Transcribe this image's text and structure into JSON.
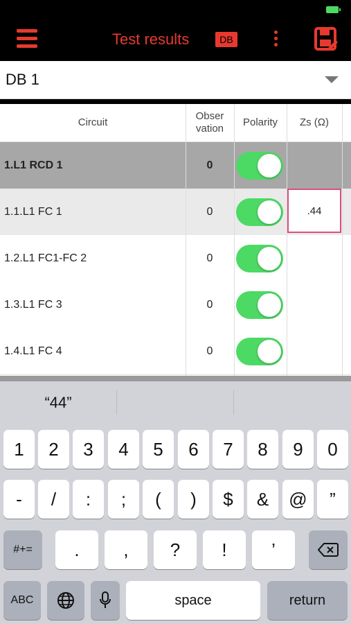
{
  "header": {
    "title": "Test results",
    "db_badge": "DB"
  },
  "db_selector": {
    "value": "DB 1"
  },
  "table": {
    "columns": [
      "Circuit",
      "Obser vation",
      "Polarity",
      "Zs (Ω)"
    ],
    "rows": [
      {
        "circuit": "1.L1 RCD 1",
        "observation": "0",
        "polarity_on": true,
        "zs": ""
      },
      {
        "circuit": "1.1.L1 FC 1",
        "observation": "0",
        "polarity_on": true,
        "zs": ".44"
      },
      {
        "circuit": "1.2.L1 FC1-FC 2",
        "observation": "0",
        "polarity_on": true,
        "zs": ""
      },
      {
        "circuit": "1.3.L1 FC 3",
        "observation": "0",
        "polarity_on": true,
        "zs": ""
      },
      {
        "circuit": "1.4.L1 FC 4",
        "observation": "0",
        "polarity_on": true,
        "zs": ""
      }
    ]
  },
  "keyboard": {
    "suggestions": [
      "“44”",
      "",
      ""
    ],
    "row1": [
      "1",
      "2",
      "3",
      "4",
      "5",
      "6",
      "7",
      "8",
      "9",
      "0"
    ],
    "row2": [
      "-",
      "/",
      ":",
      ";",
      "(",
      ")",
      "$",
      "&",
      "@",
      "”"
    ],
    "row3": [
      "#+=",
      ".",
      ",",
      "?",
      "!",
      "’"
    ],
    "space_label": "space",
    "return_label": "return",
    "abc_label": "ABC"
  },
  "colors": {
    "accent": "#e8392f",
    "toggle_on": "#4cd964",
    "active_cell_border": "#d94f7c"
  }
}
